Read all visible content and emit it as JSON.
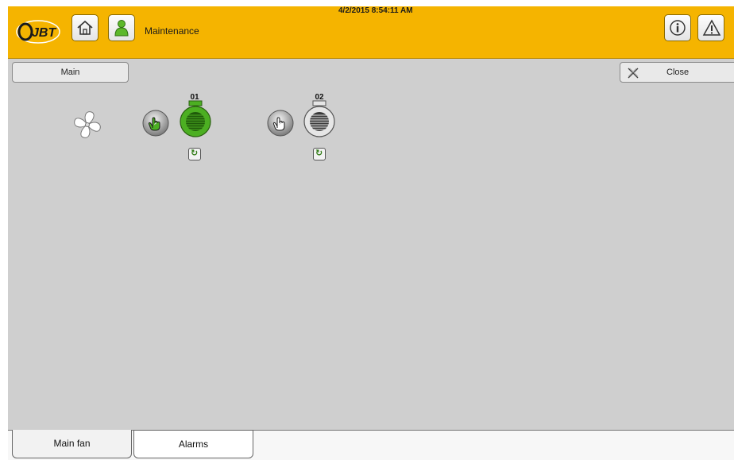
{
  "header": {
    "logo_text": "JBT",
    "screen_title": "Maintenance",
    "datetime": "4/2/2015 8:54:11 AM",
    "icons": [
      "home-icon",
      "user-icon",
      "info-icon",
      "alarm-warning-icon"
    ],
    "background_color": "#f5b400"
  },
  "top_bar": {
    "main_tab_label": "Main",
    "close_label": "Close"
  },
  "fans": [
    {
      "label": "01",
      "state": "running",
      "color": "#4caf22",
      "mode": "manual"
    },
    {
      "label": "02",
      "state": "stopped",
      "color": "#e6e6e6",
      "mode": "manual"
    }
  ],
  "bottom_tabs": [
    {
      "label": "Main fan",
      "active": true
    },
    {
      "label": "Alarms",
      "active": false
    }
  ],
  "colors": {
    "running": "#4caf22",
    "stopped": "#e6e6e6",
    "panel": "#cfcfcf"
  }
}
